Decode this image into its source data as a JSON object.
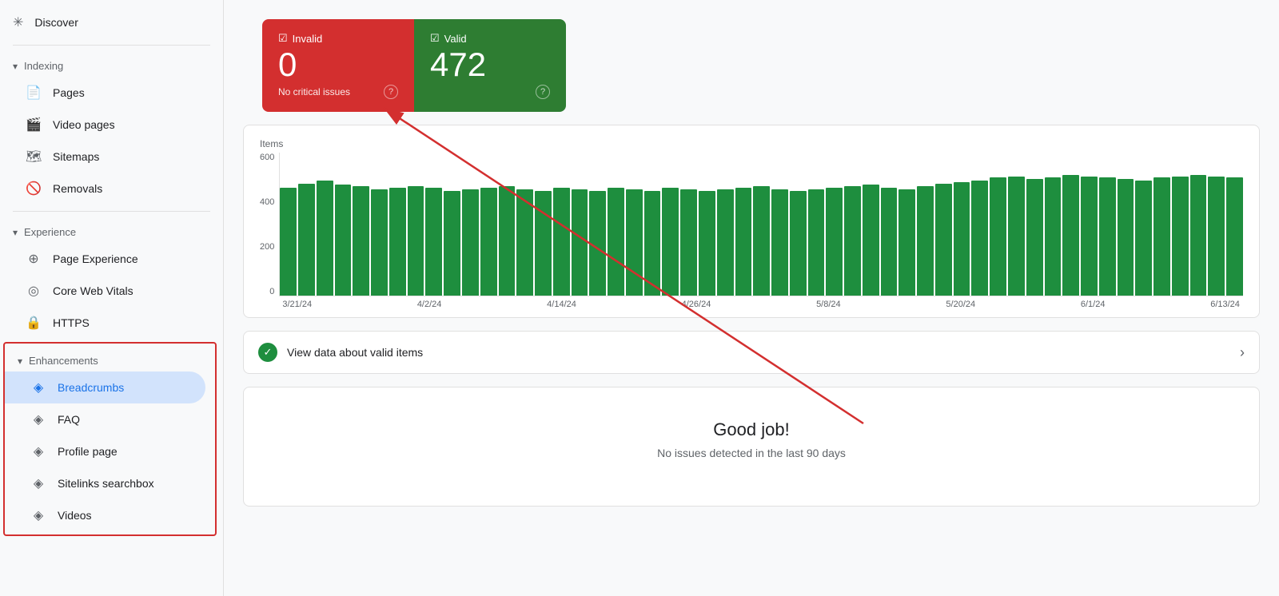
{
  "sidebar": {
    "discover_label": "Discover",
    "indexing_label": "Indexing",
    "indexing_items": [
      {
        "label": "Pages",
        "icon": "📄"
      },
      {
        "label": "Video pages",
        "icon": "🎬"
      },
      {
        "label": "Sitemaps",
        "icon": "🗺"
      },
      {
        "label": "Removals",
        "icon": "🚫"
      }
    ],
    "experience_label": "Experience",
    "experience_items": [
      {
        "label": "Page Experience",
        "icon": "⊕"
      },
      {
        "label": "Core Web Vitals",
        "icon": "◎"
      },
      {
        "label": "HTTPS",
        "icon": "🔒"
      }
    ],
    "enhancements_label": "Enhancements",
    "enhancements_items": [
      {
        "label": "Breadcrumbs",
        "icon": "◈",
        "active": true
      },
      {
        "label": "FAQ",
        "icon": "◈"
      },
      {
        "label": "Profile page",
        "icon": "◈"
      },
      {
        "label": "Sitelinks searchbox",
        "icon": "◈"
      },
      {
        "label": "Videos",
        "icon": "◈"
      }
    ]
  },
  "main": {
    "invalid_label": "Invalid",
    "valid_label": "Valid",
    "invalid_count": "0",
    "valid_count": "472",
    "invalid_sub": "No critical issues",
    "chart_y_label": "Items",
    "chart_y_values": [
      "600",
      "400",
      "200",
      "0"
    ],
    "chart_x_labels": [
      "3/21/24",
      "4/2/24",
      "4/14/24",
      "4/26/24",
      "5/8/24",
      "5/20/24",
      "6/1/24",
      "6/13/24"
    ],
    "view_data_label": "View data about valid items",
    "good_job_title": "Good job!",
    "good_job_sub": "No issues detected in the last 90 days"
  },
  "colors": {
    "invalid_bg": "#d32f2f",
    "valid_bg": "#2e7d32",
    "bar_color": "#1e8e3e",
    "active_sidebar": "#d2e3fc"
  }
}
